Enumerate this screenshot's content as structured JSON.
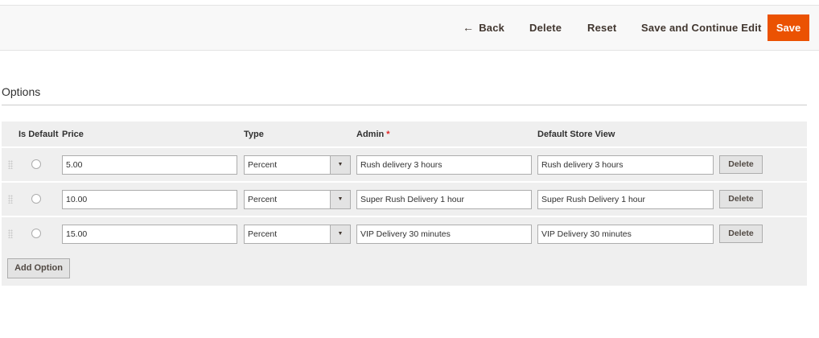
{
  "toolbar": {
    "back_arrow": "←",
    "back_label": "Back",
    "delete_label": "Delete",
    "reset_label": "Reset",
    "save_continue_label": "Save and Continue Edit",
    "save_label": "Save",
    "accent_color": "#eb5202"
  },
  "section": {
    "title": "Options"
  },
  "grid": {
    "headers": {
      "is_default": "Is Default",
      "price": "Price",
      "type": "Type",
      "admin": "Admin",
      "admin_required": "*",
      "default_store_view": "Default Store View"
    },
    "rows": [
      {
        "price": "5.00",
        "type": "Percent",
        "admin": "Rush delivery 3 hours",
        "store_view": "Rush delivery 3 hours",
        "delete_label": "Delete"
      },
      {
        "price": "10.00",
        "type": "Percent",
        "admin": "Super Rush Delivery 1 hour",
        "store_view": "Super Rush Delivery 1 hour",
        "delete_label": "Delete"
      },
      {
        "price": "15.00",
        "type": "Percent",
        "admin": "VIP Delivery 30 minutes",
        "store_view": "VIP Delivery 30 minutes",
        "delete_label": "Delete"
      }
    ],
    "caret_glyph": "▼",
    "add_option_label": "Add Option"
  }
}
